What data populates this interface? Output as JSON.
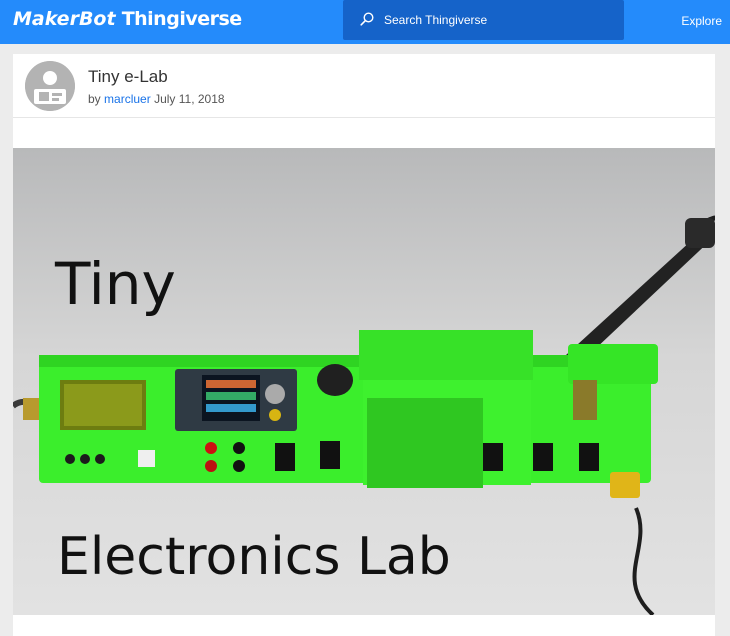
{
  "topbar": {
    "logo_prefix": "MakerBot",
    "logo_brand": "Thingiverse",
    "search_placeholder": "Search Thingiverse",
    "explore_label": "Explore",
    "bg_color": "#248bfb"
  },
  "thing": {
    "title": "Tiny e-Lab",
    "by": "by",
    "author": "marcluer",
    "date": "July 11, 2018",
    "photo": {
      "caption_top": "Tiny",
      "caption_bottom": "Electronics Lab"
    }
  }
}
